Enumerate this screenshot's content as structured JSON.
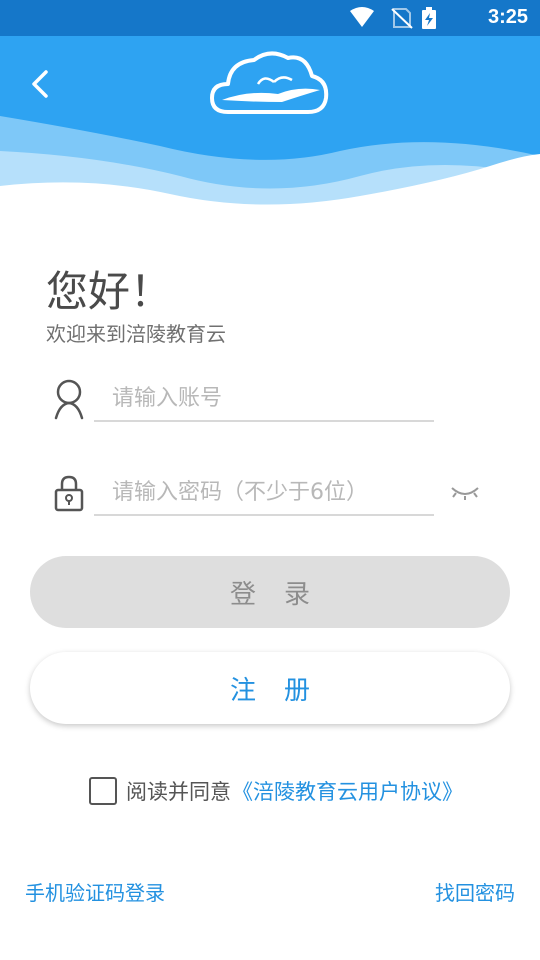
{
  "status_bar": {
    "time": "3:25"
  },
  "icons": {
    "back": "back-arrow-icon",
    "logo": "cloud-bird-logo-icon",
    "account": "user-icon",
    "password": "lock-icon",
    "visibility": "eye-closed-icon",
    "checkbox": "checkbox-unchecked-icon"
  },
  "greeting": {
    "title": "您好！",
    "subtitle": "欢迎来到涪陵教育云"
  },
  "form": {
    "account_placeholder": "请输入账号",
    "password_placeholder": "请输入密码（不少于6位）"
  },
  "buttons": {
    "login": "登录",
    "register": "注册"
  },
  "agreement": {
    "text": "阅读并同意",
    "link": "《涪陵教育云用户协议》",
    "checked": false
  },
  "footer": {
    "sms_login": "手机验证码登录",
    "find_password": "找回密码"
  },
  "colors": {
    "primary": "#2391e0",
    "header": "#2ea3f2",
    "status_bar": "#1577c9"
  }
}
